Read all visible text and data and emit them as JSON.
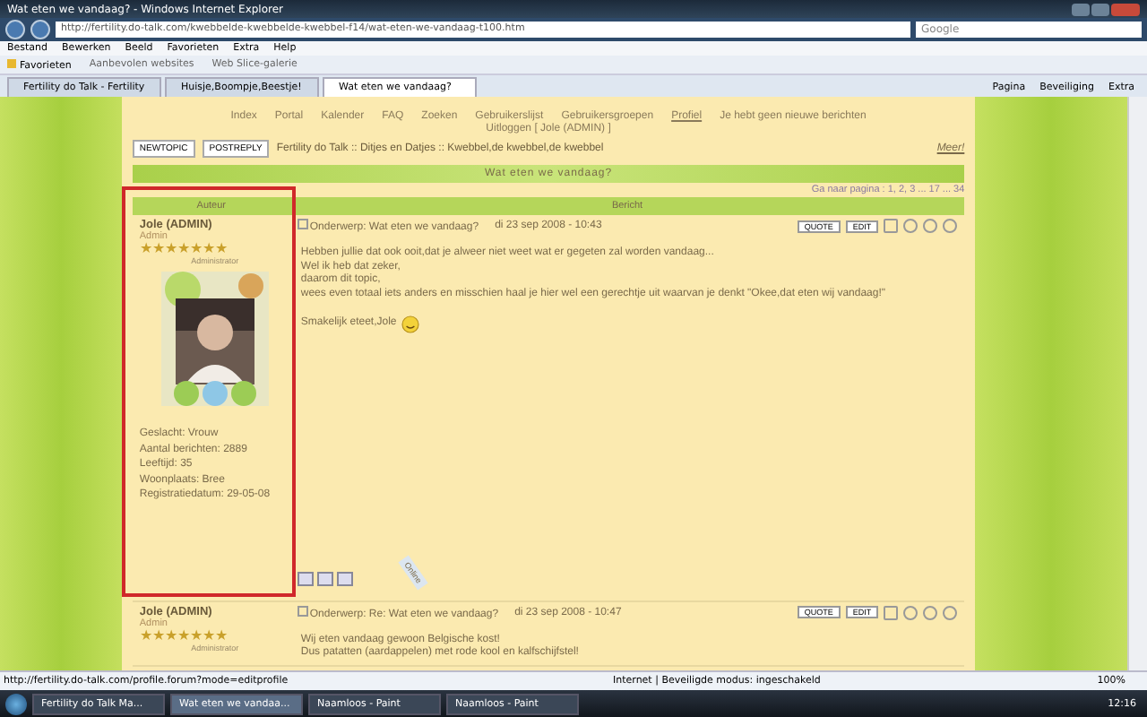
{
  "window": {
    "title": "Wat eten we vandaag? - Windows Internet Explorer"
  },
  "address_bar": {
    "url": "http://fertility.do-talk.com/kwebbelde-kwebbelde-kwebbel-f14/wat-eten-we-vandaag-t100.htm"
  },
  "search": {
    "placeholder": "Google"
  },
  "menu": [
    "Bestand",
    "Bewerken",
    "Beeld",
    "Favorieten",
    "Extra",
    "Help"
  ],
  "favorites_bar": {
    "label": "Favorieten",
    "links": [
      "Aanbevolen websites",
      "Web Slice-galerie"
    ]
  },
  "tabs": [
    {
      "label": "Fertility do Talk - Fertility",
      "selected": false
    },
    {
      "label": "Huisje,Boompje,Beestje!",
      "selected": false
    },
    {
      "label": "Wat eten we vandaag?",
      "selected": true
    }
  ],
  "toolbar": [
    "Pagina",
    "Beveiliging",
    "Extra"
  ],
  "forum_nav": [
    {
      "label": "Index",
      "selected": false
    },
    {
      "label": "Portal",
      "selected": false
    },
    {
      "label": "Kalender",
      "selected": false
    },
    {
      "label": "FAQ",
      "selected": false
    },
    {
      "label": "Zoeken",
      "selected": false
    },
    {
      "label": "Gebruikerslijst",
      "selected": false
    },
    {
      "label": "Gebruikersgroepen",
      "selected": false
    },
    {
      "label": "Profiel",
      "selected": true
    },
    {
      "label": "Je hebt geen nieuwe berichten",
      "selected": false
    },
    {
      "label": "Uitloggen [ Jole (ADMIN) ]",
      "selected": false
    }
  ],
  "action_buttons": [
    "NEWTOPIC",
    "POSTREPLY"
  ],
  "breadcrumb": "Fertility do Talk :: Ditjes en Datjes :: Kwebbel,de kwebbel,de kwebbel",
  "more_link": "Meer!",
  "topic_title": "Wat eten we vandaag?",
  "pagination": "Ga naar pagina : 1, 2, 3 ... 17 ... 34",
  "columns": [
    "Auteur",
    "Bericht"
  ],
  "posts": [
    {
      "author": "Jole (ADMIN)",
      "rank": "Admin",
      "stars": 7,
      "rank_title": "Administrator",
      "avatar": {
        "kind": "picture"
      },
      "profile": [
        "Geslacht: Vrouw",
        "Aantal berichten: 2889",
        "Leeftijd: 35",
        "Woonplaats: Bree",
        "Registratiedatum: 29-05-08"
      ],
      "subject": "Onderwerp: Wat eten we vandaag?",
      "date": "di 23 sep 2008 - 10:43",
      "body": [
        "Hebben jullie dat ook ooit,dat je alweer niet weet wat er gegeten zal worden vandaag...",
        "Wel ik heb dat zeker,",
        "daarom dit topic,",
        "wees even totaal iets anders en misschien haal je hier wel een gerechtje uit waarvan je denkt \"Okee,dat eten wij vandaag!\""
      ],
      "signature": "Smakelijk eteet,Jole",
      "online_badge": "Online",
      "post_buttons": [
        "QUOTE",
        "EDIT"
      ]
    },
    {
      "author": "Jole (ADMIN)",
      "rank": "Admin",
      "stars": 7,
      "rank_title": "Administrator",
      "subject": "Onderwerp: Re: Wat eten we vandaag?",
      "date": "di 23 sep 2008 - 10:47",
      "body": [
        "Wij eten vandaag gewoon Belgische kost!",
        "Dus patatten (aardappelen) met rode kool en kalfschijfstel!"
      ],
      "post_buttons": [
        "QUOTE",
        "EDIT"
      ]
    }
  ],
  "status_bar": {
    "url": "http://fertility.do-talk.com/profile.forum?mode=editprofile",
    "zone": "Internet | Beveiligde modus: ingeschakeld",
    "zoom": "100%"
  },
  "taskbar": {
    "items": [
      {
        "label": "Fertility do Talk Ma...",
        "selected": false
      },
      {
        "label": "Wat eten we vandaa...",
        "selected": true
      },
      {
        "label": "Naamloos - Paint",
        "selected": false
      },
      {
        "label": "Naamloos - Paint",
        "selected": false
      }
    ],
    "clock": "12:16"
  }
}
